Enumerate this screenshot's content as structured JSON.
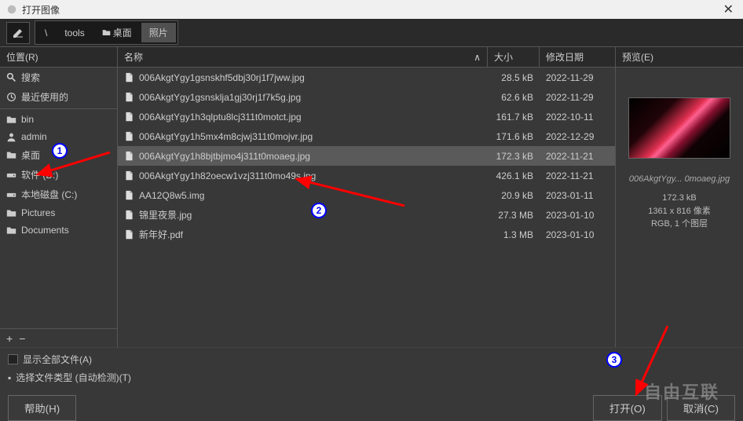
{
  "title": "打开图像",
  "breadcrumbs": [
    "\\",
    "tools",
    "桌面",
    "照片"
  ],
  "places": {
    "header": "位置(R)",
    "items_top": [
      {
        "icon": "search",
        "label": "搜索"
      },
      {
        "icon": "recent",
        "label": "最近使用的"
      }
    ],
    "items_mid": [
      {
        "icon": "folder",
        "label": "bin"
      },
      {
        "icon": "user",
        "label": "admin"
      },
      {
        "icon": "folder",
        "label": "桌面"
      },
      {
        "icon": "drive",
        "label": "软件 (D:)"
      },
      {
        "icon": "drive",
        "label": "本地磁盘 (C:)"
      },
      {
        "icon": "folder",
        "label": "Pictures"
      },
      {
        "icon": "folder",
        "label": "Documents"
      }
    ]
  },
  "filelist": {
    "cols": {
      "name": "名称",
      "size": "大小",
      "date": "修改日期"
    },
    "rows": [
      {
        "name": "006AkgtYgy1gsnskhf5dbj30rj1f7jww.jpg",
        "size": "28.5 kB",
        "date": "2022-11-29",
        "sel": false
      },
      {
        "name": "006AkgtYgy1gsnsklja1gj30rj1f7k5g.jpg",
        "size": "62.6 kB",
        "date": "2022-11-29",
        "sel": false
      },
      {
        "name": "006AkgtYgy1h3qlptu8lcj311t0motct.jpg",
        "size": "161.7 kB",
        "date": "2022-10-11",
        "sel": false
      },
      {
        "name": "006AkgtYgy1h5mx4m8cjwj311t0mojvr.jpg",
        "size": "171.6 kB",
        "date": "2022-12-29",
        "sel": false
      },
      {
        "name": "006AkgtYgy1h8bjtbjmo4j311t0moaeg.jpg",
        "size": "172.3 kB",
        "date": "2022-11-21",
        "sel": true
      },
      {
        "name": "006AkgtYgy1h82oecw1vzj311t0mo49s.jpg",
        "size": "426.1 kB",
        "date": "2022-11-21",
        "sel": false
      },
      {
        "name": "AA12Q8w5.img",
        "size": "20.9 kB",
        "date": "2023-01-11",
        "sel": false
      },
      {
        "name": "锦里夜景.jpg",
        "size": "27.3 MB",
        "date": "2023-01-10",
        "sel": false
      },
      {
        "name": "新年好.pdf",
        "size": "1.3 MB",
        "date": "2023-01-10",
        "sel": false
      }
    ]
  },
  "preview": {
    "header": "预览(E)",
    "filename": "006AkgtYgy... 0moaeg.jpg",
    "size": "172.3 kB",
    "dims": "1361 x 816 像素",
    "mode": "RGB, 1 个图层"
  },
  "options": {
    "show_all": "显示全部文件(A)",
    "filetype": "选择文件类型 (自动检测)(T)"
  },
  "buttons": {
    "help": "帮助(H)",
    "open": "打开(O)",
    "cancel": "取消(C)"
  },
  "watermark": "自由互联",
  "badges": [
    "1",
    "2",
    "3"
  ]
}
